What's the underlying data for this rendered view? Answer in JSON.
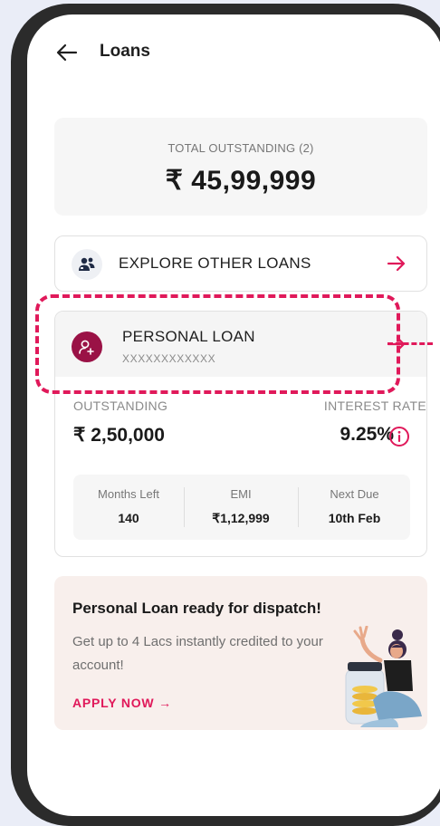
{
  "header": {
    "title": "Loans",
    "back_icon": "arrow-left-icon"
  },
  "total": {
    "label": "TOTAL OUTSTANDING (2)",
    "value": "₹ 45,99,999"
  },
  "explore": {
    "label": "EXPLORE OTHER LOANS",
    "icon": "people-icon",
    "arrow": "arrow-right-icon"
  },
  "loan": {
    "name": "PERSONAL LOAN",
    "number": "XXXXXXXXXXXX",
    "icon": "user-plus-icon",
    "outstanding_label": "OUTSTANDING",
    "outstanding_value": "₹ 2,50,000",
    "interest_label": "INTEREST RATE",
    "interest_value": "9.25%",
    "details": [
      {
        "label": "Months Left",
        "value": "140"
      },
      {
        "label": "EMI",
        "value": "₹1,12,999"
      },
      {
        "label": "Next Due",
        "value": "10th Feb"
      }
    ]
  },
  "promo": {
    "title": "Personal Loan ready for dispatch!",
    "subtitle": "Get up to 4 Lacs instantly credited to your account!",
    "cta": "APPLY NOW →",
    "illustration": "woman-with-coin-jar-illustration"
  },
  "colors": {
    "accent": "#e0195a",
    "avatar": "#9a1246",
    "frame": "#2b2b2b",
    "background": "#eaedf7"
  }
}
